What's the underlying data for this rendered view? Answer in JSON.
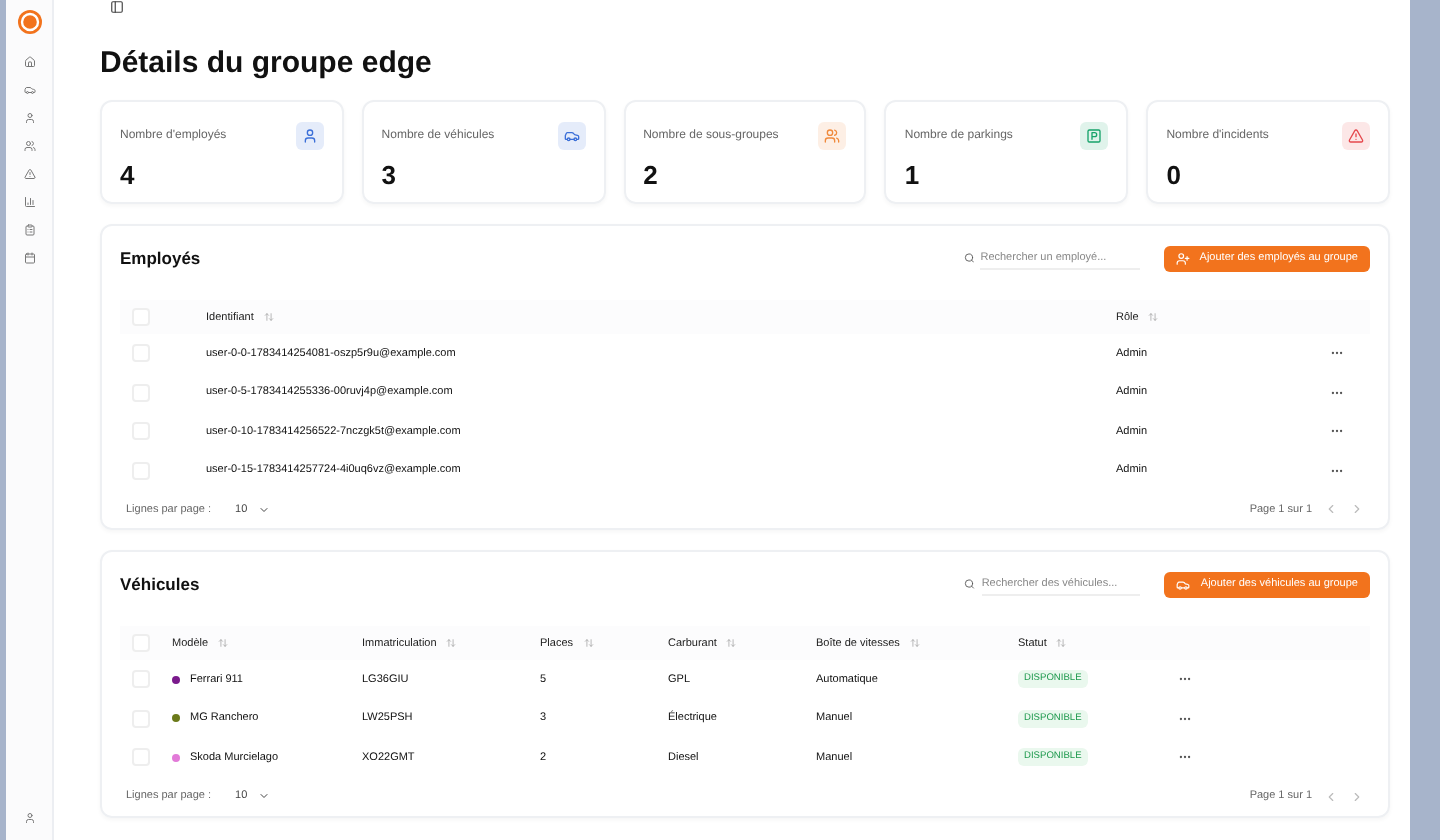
{
  "sidebar": {
    "items": [
      {
        "kind": "home",
        "selected": false
      },
      {
        "kind": "car",
        "selected": false
      },
      {
        "kind": "user",
        "selected": false
      },
      {
        "kind": "users",
        "selected": false
      },
      {
        "kind": "alert",
        "selected": false
      },
      {
        "kind": "chart",
        "selected": false
      },
      {
        "kind": "list",
        "selected": false
      },
      {
        "kind": "calendar",
        "selected": false
      }
    ],
    "footer": {
      "kind": "user"
    }
  },
  "title": "Détails du groupe edge",
  "stats": [
    {
      "label": "Nombre d'employés",
      "value": "4",
      "kind": "user",
      "color": "#3b6fd8"
    },
    {
      "label": "Nombre de véhicules",
      "value": "3",
      "kind": "car",
      "color": "#3b6fd8"
    },
    {
      "label": "Nombre de sous-groupes",
      "value": "2",
      "kind": "users",
      "color": "#f08a3c"
    },
    {
      "label": "Nombre de parkings",
      "value": "1",
      "kind": "parking",
      "color": "#16a36a"
    },
    {
      "label": "Nombre d'incidents",
      "value": "0",
      "kind": "alert",
      "color": "#e5484d"
    }
  ],
  "employees": {
    "title": "Employés",
    "search": {
      "placeholder": "Rechercher un employé..."
    },
    "add_button": "Ajouter des employés au groupe",
    "select_all": {
      "checked": false
    },
    "columns": [
      "Identifiant",
      "Rôle"
    ],
    "rows": [
      {
        "id": "user-0-0-1783414254081-oszp5r9u@example.com",
        "role": "Admin",
        "checked": false
      },
      {
        "id": "user-0-5-1783414255336-00ruvj4p@example.com",
        "role": "Admin",
        "checked": false
      },
      {
        "id": "user-0-10-1783414256522-7nczgk5t@example.com",
        "role": "Admin",
        "checked": false
      },
      {
        "id": "user-0-15-1783414257724-4i0uq6vz@example.com",
        "role": "Admin",
        "checked": false
      }
    ],
    "rows_per_page_label": "Lignes par page :",
    "rows_per_page": "10",
    "page": "Page 1 sur 1"
  },
  "vehicles": {
    "title": "Véhicules",
    "search": {
      "placeholder": "Rechercher des véhicules..."
    },
    "add_button": "Ajouter des véhicules au groupe",
    "select_all": {
      "checked": false
    },
    "columns": [
      "Modèle",
      "Immatriculation",
      "Places",
      "Carburant",
      "Boîte de vitesses",
      "Statut"
    ],
    "rows": [
      {
        "model": "Ferrari 911",
        "color": "#7a1a8c",
        "plate": "LG36GIU",
        "seats": "5",
        "fuel": "GPL",
        "gearbox": "Automatique",
        "status": "DISPONIBLE",
        "checked": false
      },
      {
        "model": "MG Ranchero",
        "color": "#6b7a1a",
        "plate": "LW25PSH",
        "seats": "3",
        "fuel": "Électrique",
        "gearbox": "Manuel",
        "status": "DISPONIBLE",
        "checked": false
      },
      {
        "model": "Skoda Murcielago",
        "color": "#e27ad8",
        "plate": "XO22GMT",
        "seats": "2",
        "fuel": "Diesel",
        "gearbox": "Manuel",
        "status": "DISPONIBLE",
        "checked": false
      }
    ],
    "rows_per_page_label": "Lignes par page :",
    "rows_per_page": "10",
    "page": "Page 1 sur 1"
  }
}
